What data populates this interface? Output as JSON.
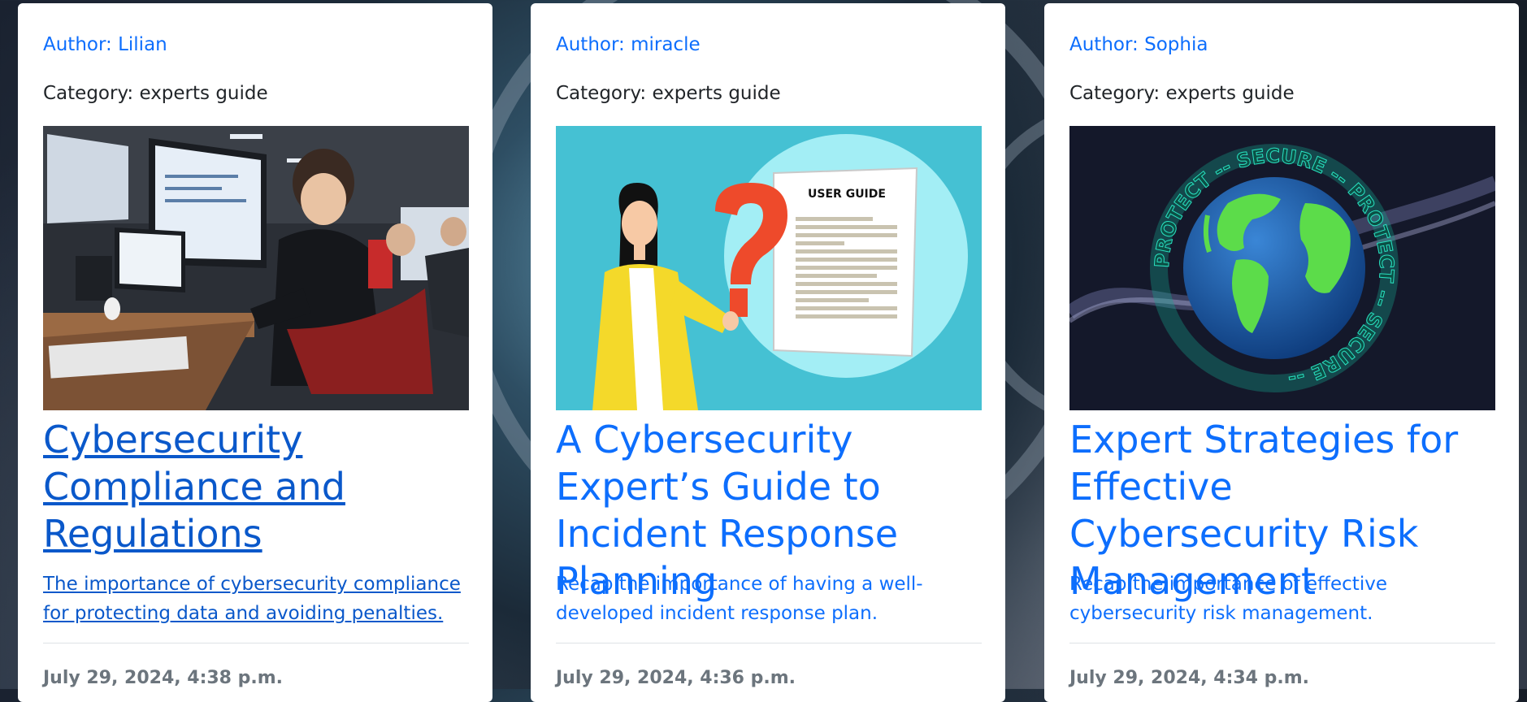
{
  "cards": [
    {
      "author": "Author: Lilian",
      "category": "Category: experts guide",
      "image_icon": "programmer-illustration-icon",
      "title": "Cybersecurity Compliance and Regulations",
      "excerpt": "The importance of cybersecurity compliance for protecting data and avoiding penalties.",
      "date": "July 29, 2024, 4:38 p.m."
    },
    {
      "author": "Author: miracle",
      "category": "Category: experts guide",
      "image_icon": "user-guide-illustration-icon",
      "image_text": "USER GUIDE",
      "title": "A Cybersecurity Expert’s Guide to Incident Response Planning",
      "excerpt": "Recap the importance of having a well-developed incident response plan.",
      "date": "July 29, 2024, 4:36 p.m."
    },
    {
      "author": "Author: Sophia",
      "category": "Category: experts guide",
      "image_icon": "globe-protect-secure-icon",
      "image_text": "PROTECT -- SECURE -- PROTECT -- SECURE --",
      "title": "Expert Strategies for Effective Cybersecurity Risk Management",
      "excerpt": "Recap the importance of effective cybersecurity risk management.",
      "date": "July 29, 2024, 4:34 p.m."
    }
  ],
  "colors": {
    "link": "#0d6efd",
    "link_hover": "#0a58ca",
    "muted": "#6c757d",
    "text": "#212529"
  }
}
